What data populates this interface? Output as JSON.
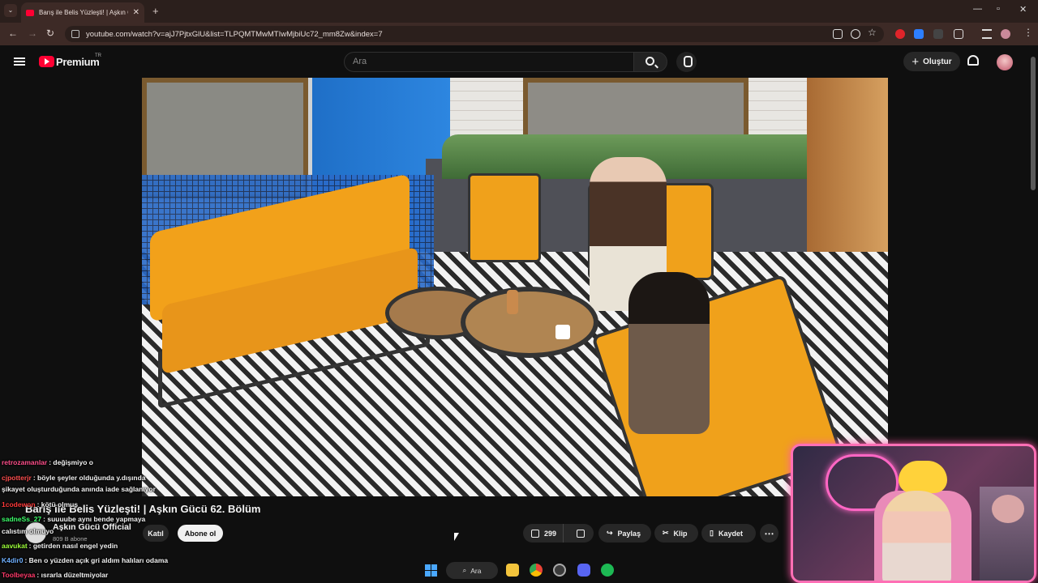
{
  "browser": {
    "tab_title": "Barış ile Belis Yüzleşti! | Aşkın Gü",
    "url": "youtube.com/watch?v=ajJ7PjtxGlU&list=TLPQMTMwMTIwMjbiUc72_mm8Zw&index=7"
  },
  "youtube": {
    "brand": "Premium",
    "country": "TR",
    "search_placeholder": "Ara",
    "create_label": "Oluştur"
  },
  "video": {
    "title": "Barış ile Belis Yüzleşti! | Aşkın Gücü 62. Bölüm",
    "channel": "Aşkın Gücü Official",
    "subscribers": "809 B abone",
    "join_label": "Katıl",
    "subscribe_label": "Abone ol",
    "likes": "299",
    "share_label": "Paylaş",
    "clip_label": "Klip",
    "save_label": "Kaydet"
  },
  "chat": [
    {
      "user": "retrozamanlar",
      "user_color": "#ff4f8b",
      "text": ": değişmiyo o"
    },
    {
      "user": "cjpotterjr",
      "user_color": "#ff4f4f",
      "text": ": böyle şeyler olduğunda y.dışında"
    },
    {
      "user": "",
      "user_color": "#ffffff",
      "text": "şikayet oluşturduğunda anında iade sağlanıyor"
    },
    {
      "user": "1codewon",
      "user_color": "#ff3a3a",
      "text": ": kötü olmuş"
    },
    {
      "user": "sadneSs_27",
      "user_color": "#3cff6a",
      "text": ": suuuube aynı bende yapmaya"
    },
    {
      "user": "",
      "user_color": "#ffffff",
      "text": "calıstım olmuyo"
    },
    {
      "user": "aavukat",
      "user_color": "#9dff3a",
      "text": ": getirden nasıl engel yedin"
    },
    {
      "user": "K4dir0",
      "user_color": "#6fb0ff",
      "text": ": Ben o yüzden açık gri aldım halıları odama"
    },
    {
      "user": "Toolbeyaa",
      "user_color": "#ff3a6a",
      "text": ": ısrarla düzeltmiyolar"
    }
  ],
  "taskbar": {
    "search_label": "Ara"
  }
}
